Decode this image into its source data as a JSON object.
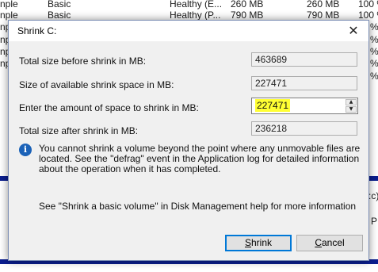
{
  "background": {
    "rows": [
      {
        "c1": "nple",
        "c2": "Basic",
        "c3": "Healthy (E...",
        "c4": "260 MB",
        "c5": "260 MB",
        "c6": "100 %"
      },
      {
        "c1": "nple",
        "c2": "Basic",
        "c3": "Healthy (P...",
        "c4": "790 MB",
        "c5": "790 MB",
        "c6": "100 %"
      },
      {
        "c1": "nple",
        "c6": "%"
      },
      {
        "c1": "nple",
        "c6": "%"
      },
      {
        "c1": "nple",
        "c6": "%"
      },
      {
        "c1": "nple",
        "c6": "%"
      }
    ],
    "right_fragments": [
      "%",
      ":c)",
      "P"
    ],
    "band_color": "#0b1e8f"
  },
  "dialog": {
    "title": "Shrink C:",
    "close_glyph": "✕",
    "fields": {
      "total_before_label": "Total size before shrink in MB:",
      "total_before_value": "463689",
      "available_label": "Size of available shrink space in MB:",
      "available_value": "227471",
      "amount_label": "Enter the amount of space to shrink in MB:",
      "amount_value": "227471",
      "total_after_label": "Total size after shrink in MB:",
      "total_after_value": "236218"
    },
    "spin_up_glyph": "▲",
    "spin_down_glyph": "▼",
    "info_icon": "info-icon",
    "info_glyph": "i",
    "info_text": "You cannot shrink a volume beyond the point where any unmovable files are located. See the \"defrag\" event in the Application log for detailed information about the operation when it has completed.",
    "help_text": "See \"Shrink a basic volume\" in Disk Management help for more information",
    "shrink_button": {
      "first": "S",
      "rest": "hrink"
    },
    "cancel_button": {
      "first": "C",
      "rest": "ancel"
    },
    "highlight_color": "#ffff33",
    "accent_color": "#0078d7"
  }
}
